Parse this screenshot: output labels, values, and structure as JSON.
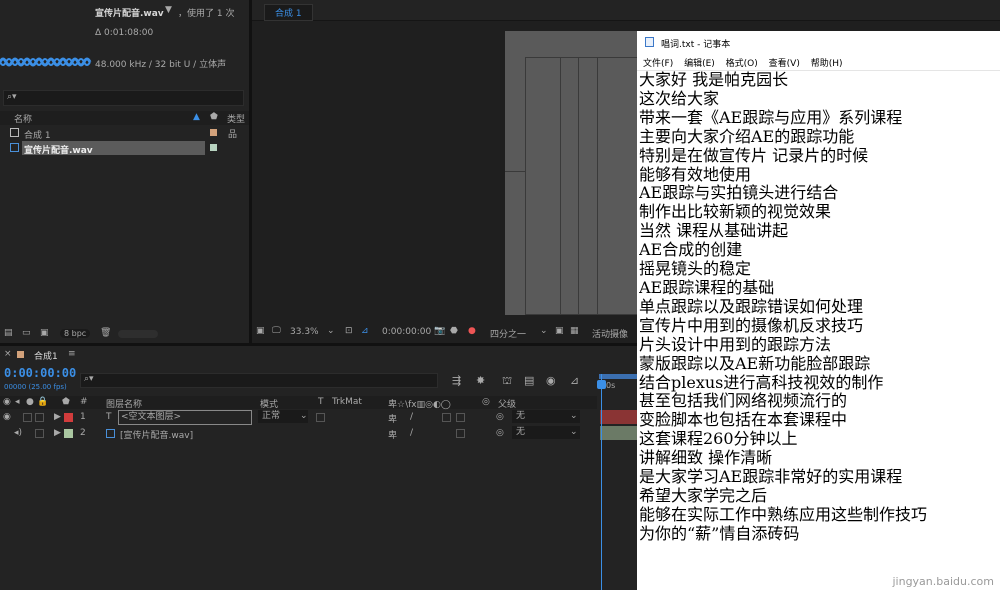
{
  "project": {
    "file_name": "宣传片配音.wav",
    "used_text": "，使用了 1 次",
    "duration": "Δ 0:01:08:00",
    "audio_info": "48.000 kHz / 32 bit U / 立体声",
    "search_placeholder": "",
    "col_name": "名称",
    "col_type": "类型",
    "items": [
      {
        "name": "合成 1"
      },
      {
        "name": "宣传片配音.wav"
      }
    ],
    "bpc": "8 bpc"
  },
  "viewer": {
    "tab": "合成 1",
    "zoom": "33.3%",
    "timecode": "0:00:00:00",
    "view": "四分之一",
    "camera": "活动摄像"
  },
  "timeline": {
    "comp_tab": "合成1",
    "current_time": "0:00:00:00",
    "fps": "00000 (25.00 fps)",
    "headers": {
      "num": "#",
      "layer_name": "图层名称",
      "mode": "模式",
      "t": "T",
      "trkmat": "TrkMat",
      "parent": "父级"
    },
    "ruler_label": "0s",
    "layers": [
      {
        "num": "1",
        "type": "T",
        "name": "<空文本图层>",
        "mode": "正常",
        "parent": "无",
        "color": "#d13c3c"
      },
      {
        "num": "2",
        "type": "",
        "name": "[宣传片配音.wav]",
        "mode": "",
        "parent": "无",
        "color": "#a9c6a0"
      }
    ]
  },
  "notepad": {
    "title": "唱词.txt - 记事本",
    "menu": [
      "文件(F)",
      "编辑(E)",
      "格式(O)",
      "查看(V)",
      "帮助(H)"
    ],
    "lines": [
      "大家好 我是帕克园长",
      "这次给大家",
      "带来一套《AE跟踪与应用》系列课程",
      "主要向大家介绍AE的跟踪功能",
      "特别是在做宣传片 记录片的时候",
      "能够有效地使用",
      "AE跟踪与实拍镜头进行结合",
      "制作出比较新颖的视觉效果",
      "当然 课程从基础讲起",
      "AE合成的创建",
      "摇晃镜头的稳定",
      "AE跟踪课程的基础",
      "单点跟踪以及跟踪错误如何处理",
      "宣传片中用到的摄像机反求技巧",
      "片头设计中用到的跟踪方法",
      "蒙版跟踪以及AE新功能脸部跟踪",
      "结合plexus进行高科技视效的制作",
      "甚至包括我们网络视频流行的",
      "变脸脚本也包括在本套课程中",
      "这套课程260分钟以上",
      "讲解细致 操作清晰",
      "是大家学习AE跟踪非常好的实用课程",
      "希望大家学完之后",
      "能够在实际工作中熟练应用这些制作技巧",
      "为你的“薪”情自添砖码"
    ],
    "watermark": "jingyan.baidu.com"
  }
}
